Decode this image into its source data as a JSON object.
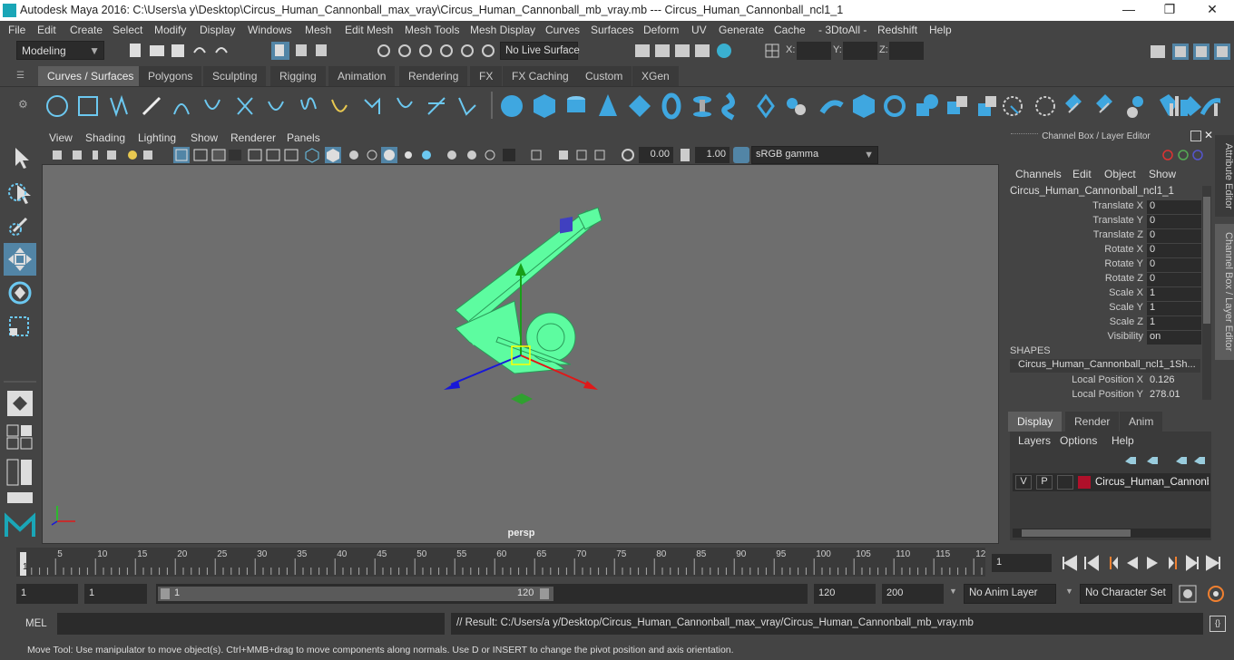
{
  "window": {
    "title": "Autodesk Maya 2016: C:\\Users\\a y\\Desktop\\Circus_Human_Cannonball_max_vray\\Circus_Human_Cannonball_mb_vray.mb  ---   Circus_Human_Cannonball_ncl1_1",
    "minimize": "—",
    "maximize": "❐",
    "close": "✕"
  },
  "menubar": [
    "File",
    "Edit",
    "Create",
    "Select",
    "Modify",
    "Display",
    "Windows",
    "Mesh",
    "Edit Mesh",
    "Mesh Tools",
    "Mesh Display",
    "Curves",
    "Surfaces",
    "Deform",
    "UV",
    "Generate",
    "Cache",
    "- 3DtoAll -",
    "Redshift",
    "Help"
  ],
  "statusline": {
    "mode": "Modeling",
    "live_surface": "No Live Surface",
    "x_label": "X:",
    "y_label": "Y:",
    "z_label": "Z:"
  },
  "shelf_tabs": [
    "Curves / Surfaces",
    "Polygons",
    "Sculpting",
    "Rigging",
    "Animation",
    "Rendering",
    "FX",
    "FX Caching",
    "Custom",
    "XGen"
  ],
  "viewport": {
    "menu": [
      "View",
      "Shading",
      "Lighting",
      "Show",
      "Renderer",
      "Panels"
    ],
    "exposure": "0.00",
    "gamma": "1.00",
    "color_space": "sRGB gamma",
    "camera_label": "persp",
    "model_color": "#5dfca0"
  },
  "channel_box": {
    "header": "Channel Box / Layer Editor",
    "menu": [
      "Channels",
      "Edit",
      "Object",
      "Show"
    ],
    "object_name": "Circus_Human_Cannonball_ncl1_1",
    "attributes": [
      {
        "name": "Translate X",
        "value": "0"
      },
      {
        "name": "Translate Y",
        "value": "0"
      },
      {
        "name": "Translate Z",
        "value": "0"
      },
      {
        "name": "Rotate X",
        "value": "0"
      },
      {
        "name": "Rotate Y",
        "value": "0"
      },
      {
        "name": "Rotate Z",
        "value": "0"
      },
      {
        "name": "Scale X",
        "value": "1"
      },
      {
        "name": "Scale Y",
        "value": "1"
      },
      {
        "name": "Scale Z",
        "value": "1"
      },
      {
        "name": "Visibility",
        "value": "on"
      }
    ],
    "shapes_label": "SHAPES",
    "shape_name": "Circus_Human_Cannonball_ncl1_1Sh...",
    "shape_attrs": [
      {
        "name": "Local Position X",
        "value": "0.126"
      },
      {
        "name": "Local Position Y",
        "value": "278.01"
      }
    ]
  },
  "layer_editor": {
    "tabs": [
      "Display",
      "Render",
      "Anim"
    ],
    "menu": [
      "Layers",
      "Options",
      "Help"
    ],
    "layer": {
      "v": "V",
      "p": "P",
      "name": "Circus_Human_Cannonb",
      "color": "#b0102a"
    }
  },
  "side_tabs": [
    "Attribute Editor",
    "Channel Box / Layer Editor"
  ],
  "timeline": {
    "ticks": [
      "5",
      "10",
      "15",
      "20",
      "25",
      "30",
      "35",
      "40",
      "45",
      "50",
      "55",
      "60",
      "65",
      "70",
      "75",
      "80",
      "85",
      "90",
      "95",
      "100",
      "105",
      "110",
      "115",
      "12"
    ],
    "start_marker": "1",
    "current_frame": "1"
  },
  "range": {
    "start": "1",
    "anim_start": "1",
    "slider_start": "1",
    "slider_end": "120",
    "anim_end": "120",
    "end": "200",
    "anim_layer": "No Anim Layer",
    "char_set": "No Character Set"
  },
  "cmdline": {
    "label": "MEL",
    "result": "// Result: C:/Users/a y/Desktop/Circus_Human_Cannonball_max_vray/Circus_Human_Cannonball_mb_vray.mb"
  },
  "help_line": "Move Tool: Use manipulator to move object(s). Ctrl+MMB+drag to move components along normals. Use D or INSERT to change the pivot position and axis orientation."
}
